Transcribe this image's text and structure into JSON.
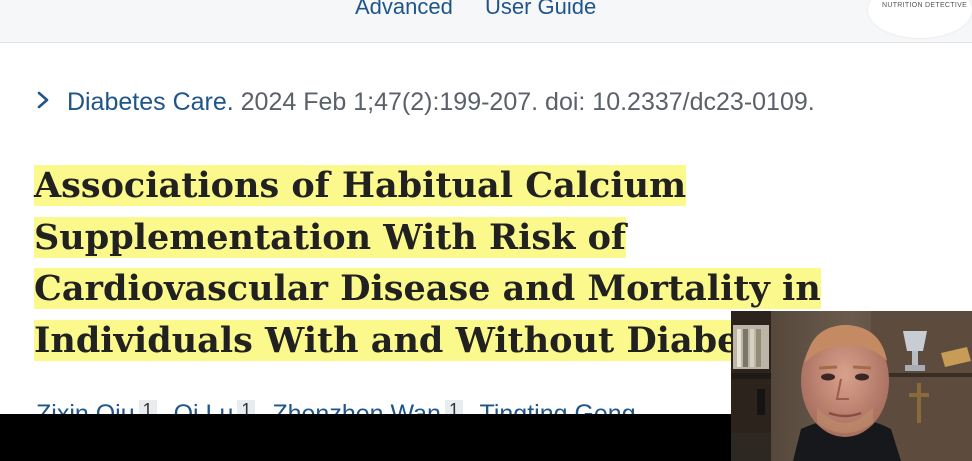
{
  "top_nav": {
    "advanced_label": "Advanced",
    "user_guide_label": "User Guide"
  },
  "logo": {
    "text": "NUTRITION DETECTIVE"
  },
  "citation": {
    "journal": "Diabetes Care.",
    "details": "2024 Feb 1;47(2):199-207. doi: 10.2337/dc23-0109."
  },
  "article": {
    "title": "Associations of Habitual Calcium Supplementation With Risk of Cardiovascular Disease and Mortality in Individuals With and Without Diabetes"
  },
  "authors": {
    "items": [
      {
        "name": "Zixin Qiu",
        "sup": "1"
      },
      {
        "name": "Qi Lu",
        "sup": "1"
      },
      {
        "name": "Zhenzhen Wan",
        "sup": "1"
      },
      {
        "name": "Tingting Geng",
        "sup": ""
      }
    ]
  },
  "colors": {
    "link": "#20558a",
    "highlight": "#fbf98b",
    "text": "#212121",
    "muted": "#5b616b"
  }
}
